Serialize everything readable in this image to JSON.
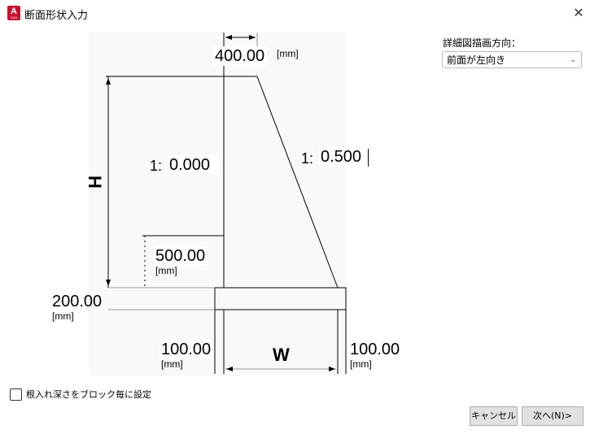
{
  "window": {
    "title": "断面形状入力",
    "app_icon_letter": "A",
    "app_icon_sub": "CAD",
    "close_glyph": "✕"
  },
  "diagram": {
    "top_width": {
      "value": "400.00",
      "unit": "[mm]"
    },
    "left_slope": {
      "prefix": "1:",
      "value": "0.000"
    },
    "right_slope": {
      "prefix": "1:",
      "value": "0.500"
    },
    "step_height": {
      "value": "500.00",
      "unit": "[mm]"
    },
    "base_height": {
      "value": "200.00",
      "unit": "[mm]"
    },
    "left_toe": {
      "value": "100.00",
      "unit": "[mm]"
    },
    "right_toe": {
      "value": "100.00",
      "unit": "[mm]"
    },
    "height_label": "H",
    "width_label": "W"
  },
  "direction": {
    "label": "詳細図描画方向：",
    "selected": "前面が左向き",
    "chevron": "⌄"
  },
  "footer": {
    "checkbox_label": "根入れ深さをブロック毎に設定",
    "checkbox_checked": false,
    "cancel_label": "キャンセル",
    "next_label": "次へ(N)>"
  }
}
